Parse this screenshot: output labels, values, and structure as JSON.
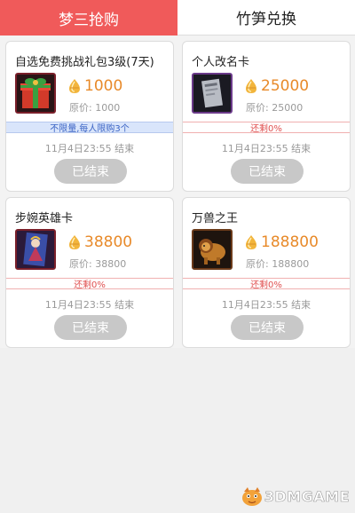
{
  "tabs": [
    {
      "label": "梦三抢购",
      "active": true
    },
    {
      "label": "竹笋兑换",
      "active": false
    }
  ],
  "colors": {
    "accent": "#f05a5a",
    "price": "#e88a2a",
    "band_blue_text": "#3a63c4",
    "band_red_text": "#e05050",
    "ended_button": "#c8c8c8"
  },
  "items": [
    {
      "title": "自选免费挑战礼包3级(7天)",
      "price": "1000",
      "original": "原价:  1000",
      "band": "不限量,每人限购3个",
      "band_style": "blue",
      "end_time": "11月4日23:55  结束",
      "status": "已结束",
      "thumb_icon": "gift-box-icon"
    },
    {
      "title": "个人改名卡",
      "price": "25000",
      "original": "原价:  25000",
      "band": "还剩0%",
      "band_style": "red",
      "end_time": "11月4日23:55  结束",
      "status": "已结束",
      "thumb_icon": "rename-card-icon"
    },
    {
      "title": "步婉英雄卡",
      "price": "38800",
      "original": "原价:  38800",
      "band": "还剩0%",
      "band_style": "red",
      "end_time": "11月4日23:55  结束",
      "status": "已结束",
      "thumb_icon": "hero-card-icon"
    },
    {
      "title": "万兽之王",
      "price": "188800",
      "original": "原价:  188800",
      "band": "还剩0%",
      "band_style": "red",
      "end_time": "11月4日23:55  结束",
      "status": "已结束",
      "thumb_icon": "beast-king-icon"
    }
  ],
  "watermark": {
    "text": "3DMGAME",
    "icon": "mascot-logo-icon"
  },
  "currency_icon": "bamboo-shoot-coin-icon"
}
